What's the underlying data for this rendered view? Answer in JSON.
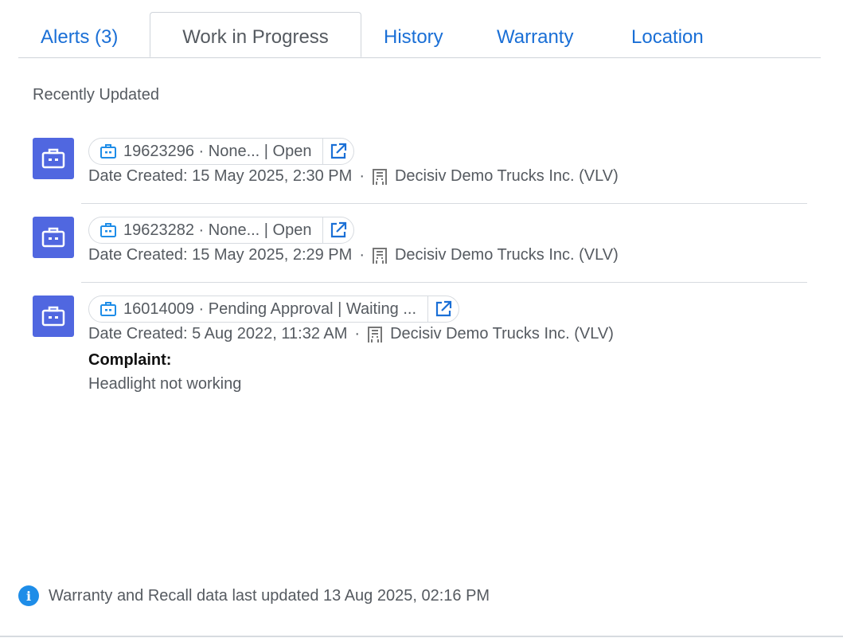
{
  "tabs": [
    {
      "label": "Alerts (3)",
      "active": false
    },
    {
      "label": "Work in Progress",
      "active": true
    },
    {
      "label": "History",
      "active": false
    },
    {
      "label": "Warranty",
      "active": false
    },
    {
      "label": "Location",
      "active": false
    }
  ],
  "section_label": "Recently Updated",
  "items": [
    {
      "summary": "19623296 · None... | Open",
      "date_created": "Date Created: 15 May 2025, 2:30 PM",
      "separator": "·",
      "dealer": "Decisiv Demo Trucks Inc. (VLV)"
    },
    {
      "summary": "19623282 · None... | Open",
      "date_created": "Date Created: 15 May 2025, 2:29 PM",
      "separator": "·",
      "dealer": "Decisiv Demo Trucks Inc. (VLV)"
    },
    {
      "summary": "16014009 · Pending Approval | Waiting ...",
      "date_created": "Date Created: 5 Aug 2022, 11:32 AM",
      "separator": "·",
      "dealer": "Decisiv Demo Trucks Inc. (VLV)",
      "complaint_label": "Complaint:",
      "complaint_text": "Headlight not working"
    }
  ],
  "footer": {
    "info_icon": "i",
    "text": "Warranty and Recall data last updated 13 Aug 2025, 02:16 PM"
  },
  "colors": {
    "accent": "#1a6fd6",
    "item_icon_bg": "#5067e0",
    "info_blue": "#1e8de8"
  },
  "icons": {
    "item": "case-icon",
    "pill": "case-small-icon",
    "link": "external-link-icon",
    "dealer": "building-icon",
    "footer": "info-icon"
  }
}
